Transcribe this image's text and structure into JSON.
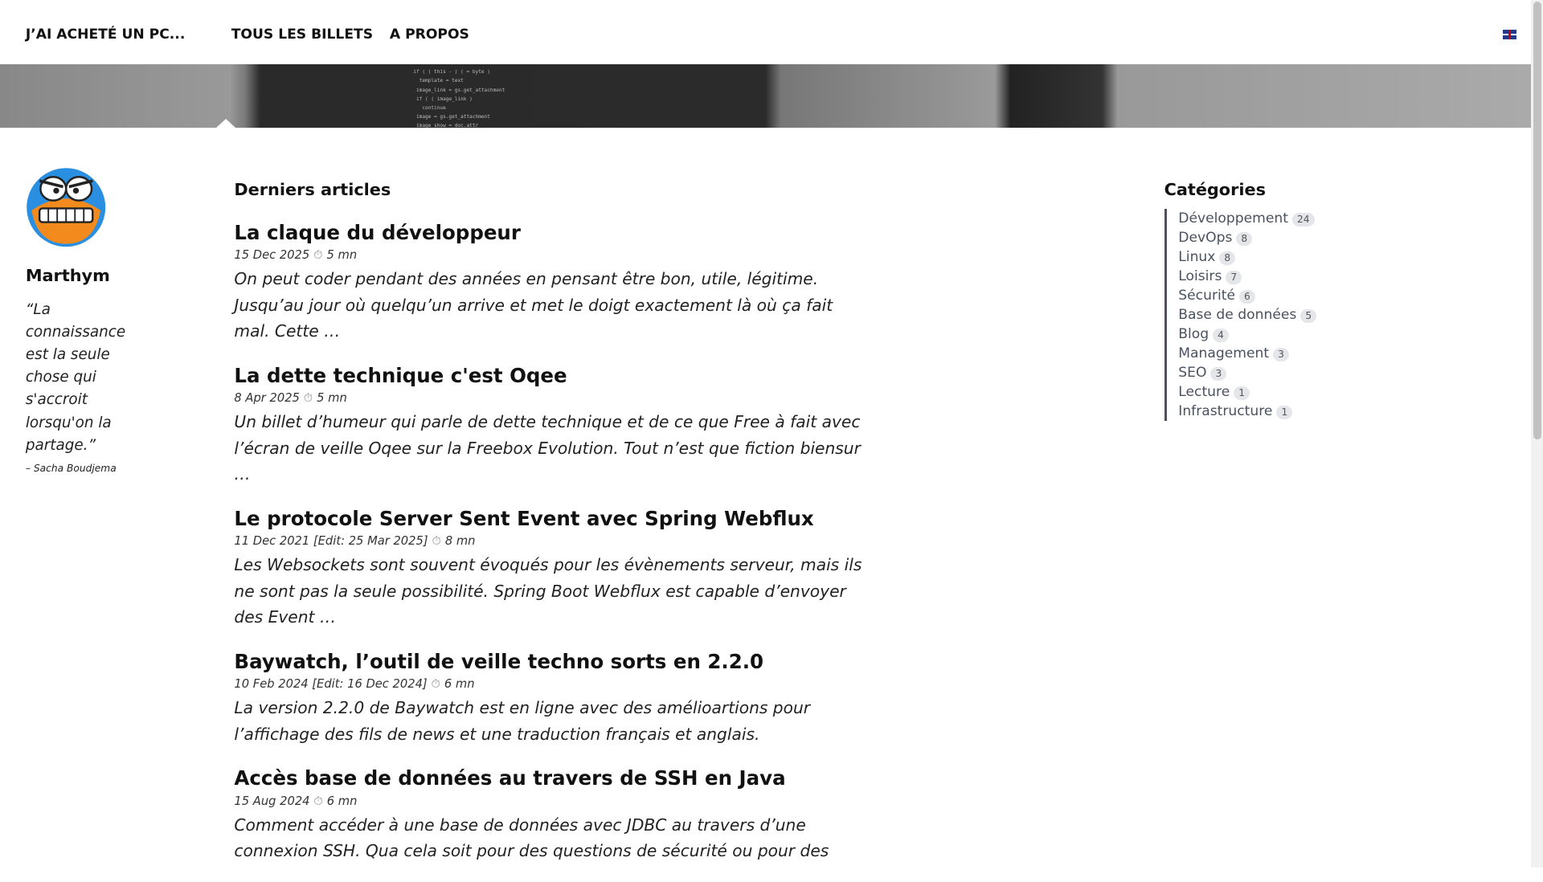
{
  "nav": {
    "brand": "J’AI ACHETÉ UN PC...",
    "links": [
      "TOUS LES BILLETS",
      "A PROPOS"
    ],
    "lang_icon": "uk-flag-icon"
  },
  "author": {
    "name": "Marthym",
    "quote": "“La connaissance est la seule chose qui s'accroit lorsqu'on la partage.”",
    "quote_source": "– Sacha Boudjema"
  },
  "main": {
    "heading": "Derniers articles",
    "posts": [
      {
        "title": "La claque du développeur",
        "date": "15 Dec 2025",
        "read": "5 mn",
        "excerpt": "On peut coder pendant des années en pensant être bon, utile, légitime. Jusqu’au jour où quelqu’un arrive et met le doigt exactement là où ça fait mal. Cette …"
      },
      {
        "title": "La dette technique c'est Oqee",
        "date": "8 Apr 2025",
        "read": "5 mn",
        "excerpt": "Un billet d’humeur qui parle de dette technique et de ce que Free à fait avec l’écran de veille Oqee sur la Freebox Evolution. Tout n’est que fiction biensur …"
      },
      {
        "title": "Le protocole Server Sent Event avec Spring Webflux",
        "date": "11 Dec 2021 [Edit: 25 Mar 2025]",
        "read": "8 mn",
        "excerpt": "Les Websockets sont souvent évoqués pour les évènements serveur, mais ils ne sont pas la seule possibilité. Spring Boot Webflux est capable d’envoyer des Event …"
      },
      {
        "title": "Baywatch, l’outil de veille techno sorts en 2.2.0",
        "date": "10 Feb 2024 [Edit: 16 Dec 2024]",
        "read": "6 mn",
        "excerpt": "La version 2.2.0 de Baywatch est en ligne avec des amélioartions pour l’affichage des fils de news et une traduction français et anglais."
      },
      {
        "title": "Accès base de données au travers de SSH en Java",
        "date": "15 Aug 2024",
        "read": "6 mn",
        "excerpt": "Comment accéder à une base de données avec JDBC au travers d’une connexion SSH. Qua cela soit pour des questions de sécurité ou pour des"
      }
    ]
  },
  "categories": {
    "heading": "Catégories",
    "items": [
      {
        "label": "Développement",
        "count": "24"
      },
      {
        "label": "DevOps",
        "count": "8"
      },
      {
        "label": "Linux",
        "count": "8"
      },
      {
        "label": "Loisirs",
        "count": "7"
      },
      {
        "label": "Sécurité",
        "count": "6"
      },
      {
        "label": "Base de données",
        "count": "5"
      },
      {
        "label": "Blog",
        "count": "4"
      },
      {
        "label": "Management",
        "count": "3"
      },
      {
        "label": "SEO",
        "count": "3"
      },
      {
        "label": "Lecture",
        "count": "1"
      },
      {
        "label": "Infrastructure",
        "count": "1"
      }
    ]
  }
}
